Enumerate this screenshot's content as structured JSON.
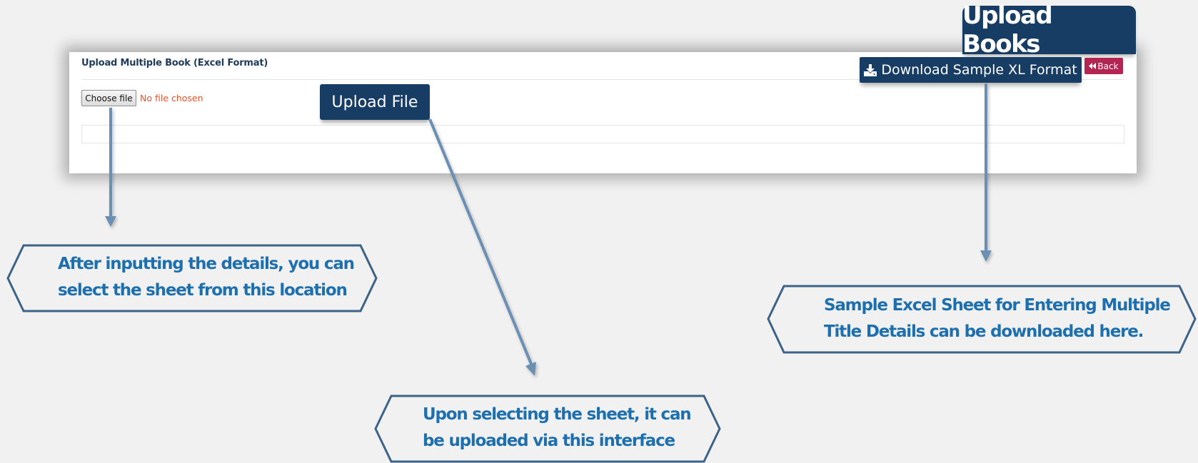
{
  "page": {
    "heading": "Upload Books"
  },
  "card": {
    "title": "Upload Multiple Book (Excel Format)",
    "choose_file_label": "Choose file",
    "no_file_text": "No file chosen",
    "download_label": "Download Sample XL Format",
    "back_label": "Back"
  },
  "upload_button": {
    "label": "Upload File"
  },
  "callouts": {
    "choose": {
      "line1": "After inputting the details, you can",
      "line2": "select the sheet from this location"
    },
    "upload": {
      "line1": "Upon selecting the sheet, it can",
      "line2": "be uploaded via this interface"
    },
    "download": {
      "line1": "Sample Excel Sheet for Entering Multiple",
      "line2": "Title Details can be downloaded here."
    }
  },
  "icons": {
    "download": "download-icon",
    "back": "backward-icon"
  },
  "colors": {
    "navy": "#173d64",
    "callout_text": "#1d6fae",
    "callout_border": "#3d6388",
    "back_button": "#b32553",
    "no_file_text": "#e8542a",
    "background": "#f1f1f1"
  }
}
